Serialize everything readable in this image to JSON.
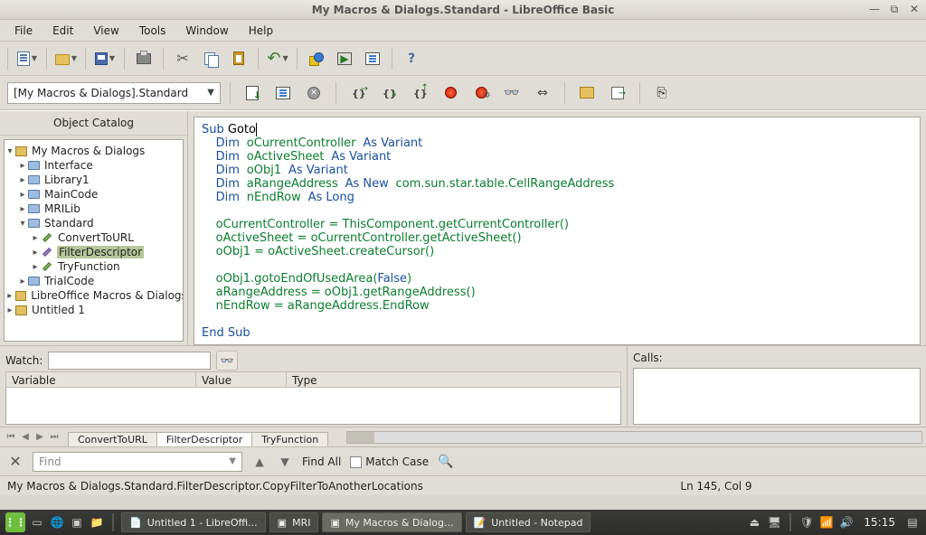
{
  "titlebar": {
    "title": "My Macros & Dialogs.Standard - LibreOffice Basic"
  },
  "menu": {
    "file": "File",
    "edit": "Edit",
    "view": "View",
    "tools": "Tools",
    "window": "Window",
    "help": "Help"
  },
  "toolbar2": {
    "library_combo": "[My Macros & Dialogs].Standard"
  },
  "catalog": {
    "header": "Object Catalog",
    "root1": "My Macros & Dialogs",
    "iface": "Interface",
    "lib1": "Library1",
    "maincode": "MainCode",
    "mrilib": "MRILib",
    "standard": "Standard",
    "convert": "ConvertToURL",
    "filter": "FilterDescriptor",
    "tryfunc": "TryFunction",
    "trial": "TrialCode",
    "root2": "LibreOffice Macros & Dialogs",
    "root3": "Untitled 1"
  },
  "code": {
    "l1a": "Sub",
    "l1b": " Goto",
    "l2a": "Dim",
    "l2b": "oCurrentController",
    "l2c": "As Variant",
    "l3a": "Dim",
    "l3b": "oActiveSheet",
    "l3c": "As Variant",
    "l4a": "Dim",
    "l4b": "oObj1",
    "l4c": "As Variant",
    "l5a": "Dim",
    "l5b": "aRangeAddress",
    "l5c": "As New",
    "l5d": "com.sun.star.table.CellRangeAddress",
    "l6a": "Dim",
    "l6b": "nEndRow",
    "l6c": "As Long",
    "l8a": "oCurrentController = ThisComponent.getCurrentController()",
    "l9a": "oActiveSheet = oCurrentController.getActiveSheet()",
    "l10a": "oObj1 = oActiveSheet.createCursor()",
    "l12a": "oObj1.gotoEndOfUsedArea(",
    "l12b": "False",
    "l12c": ")",
    "l13a": "aRangeAddress = oObj1.getRangeAddress()",
    "l14a": "nEndRow = aRangeAddress.EndRow",
    "l16a": "End Sub"
  },
  "watch": {
    "label": "Watch:",
    "col1": "Variable",
    "col2": "Value",
    "col3": "Type"
  },
  "calls": {
    "label": "Calls:"
  },
  "modtabs": {
    "t1": "ConvertToURL",
    "t2": "FilterDescriptor",
    "t3": "TryFunction"
  },
  "find": {
    "placeholder": "Find",
    "findall": "Find All",
    "matchcase": "Match Case"
  },
  "status": {
    "path": "My Macros & Dialogs.Standard.FilterDescriptor.CopyFilterToAnotherLocations",
    "lncol": "Ln 145, Col 9"
  },
  "taskbar": {
    "t1": "Untitled 1 - LibreOffi...",
    "t2": "MRI",
    "t3": "My Macros & Dialog...",
    "t4": "Untitled - Notepad",
    "clock": "15:15"
  }
}
